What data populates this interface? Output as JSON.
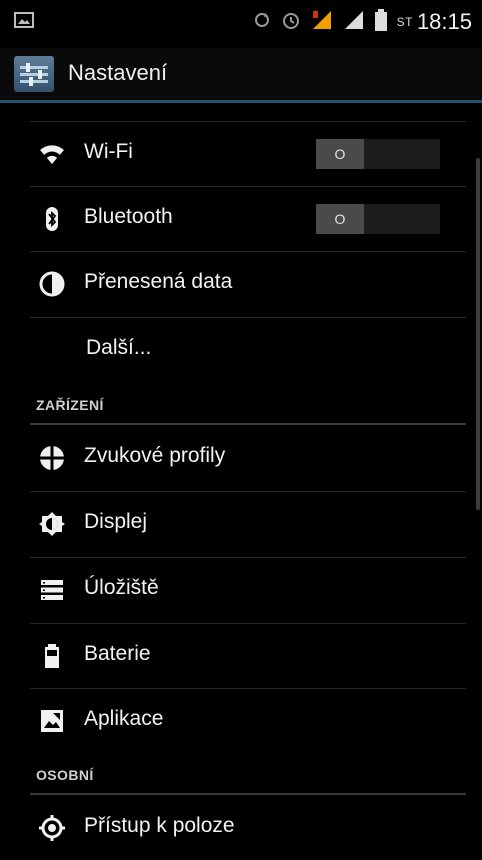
{
  "status_bar": {
    "carrier": "ST",
    "time": "18:15",
    "icons": [
      "notification-image-icon",
      "sync-icon",
      "alarm-icon",
      "data-signal-icon",
      "signal-icon",
      "battery-icon"
    ]
  },
  "action_bar": {
    "title": "Nastavení",
    "icon": "settings-app-icon"
  },
  "settings": {
    "wireless": [
      {
        "label": "Wi-Fi",
        "icon": "wifi-icon",
        "toggle": "O"
      },
      {
        "label": "Bluetooth",
        "icon": "bluetooth-icon",
        "toggle": "O"
      },
      {
        "label": "Přenesená data",
        "icon": "data-usage-icon"
      },
      {
        "label": "Další..."
      }
    ],
    "device_header": "ZAŘÍZENÍ",
    "device": [
      {
        "label": "Zvukové profily",
        "icon": "sound-profiles-icon"
      },
      {
        "label": "Displej",
        "icon": "display-icon"
      },
      {
        "label": "Úložiště",
        "icon": "storage-icon"
      },
      {
        "label": "Baterie",
        "icon": "battery-icon"
      },
      {
        "label": "Aplikace",
        "icon": "apps-icon"
      }
    ],
    "personal_header": "OSOBNÍ",
    "personal": [
      {
        "label": "Přístup k poloze",
        "icon": "location-icon"
      }
    ]
  },
  "colors": {
    "background": "#000000",
    "accent_rule": "#2a4f6a",
    "divider": "#262626",
    "toggle_knob": "#4a4a4a"
  }
}
